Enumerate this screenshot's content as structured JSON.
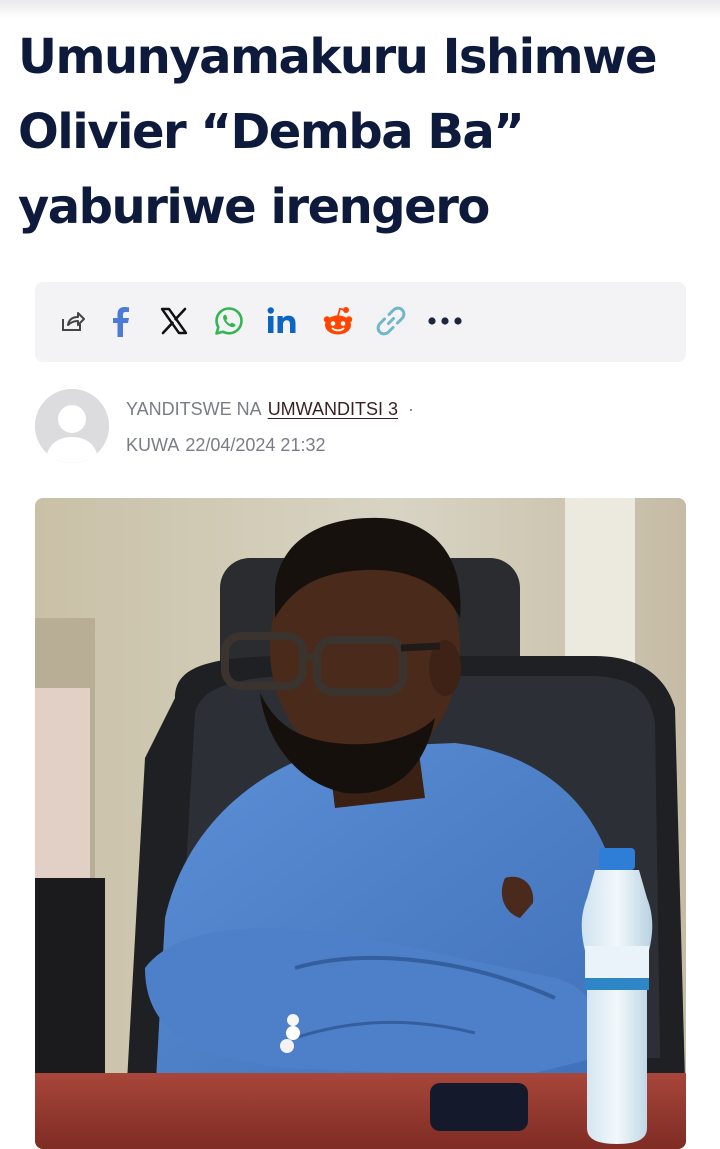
{
  "article": {
    "title": "Umunyamakuru Ishimwe Olivier “Demba Ba” yaburiwe irengero"
  },
  "share_bar": {
    "icons": [
      "share-icon",
      "facebook-icon",
      "x-icon",
      "whatsapp-icon",
      "linkedin-icon",
      "reddit-icon",
      "copy-link-icon",
      "more-icon"
    ],
    "colors": {
      "facebook": "#4a7bd6",
      "x": "#111111",
      "whatsapp": "#34b553",
      "linkedin": "#0a66c2",
      "reddit": "#ff4500",
      "copy_link": "#6fb7c9",
      "more": "#1d2540"
    }
  },
  "byline": {
    "author_prefix": "YANDITSWE NA",
    "author_name": "UMWANDITSI 3",
    "separator": "·",
    "date_prefix": "KUWA",
    "date": "22/04/2024 21:32"
  },
  "colors": {
    "headline": "#0d1a3c",
    "share_bar_bg": "#f3f3f5",
    "byline_text": "#7b7d86"
  }
}
